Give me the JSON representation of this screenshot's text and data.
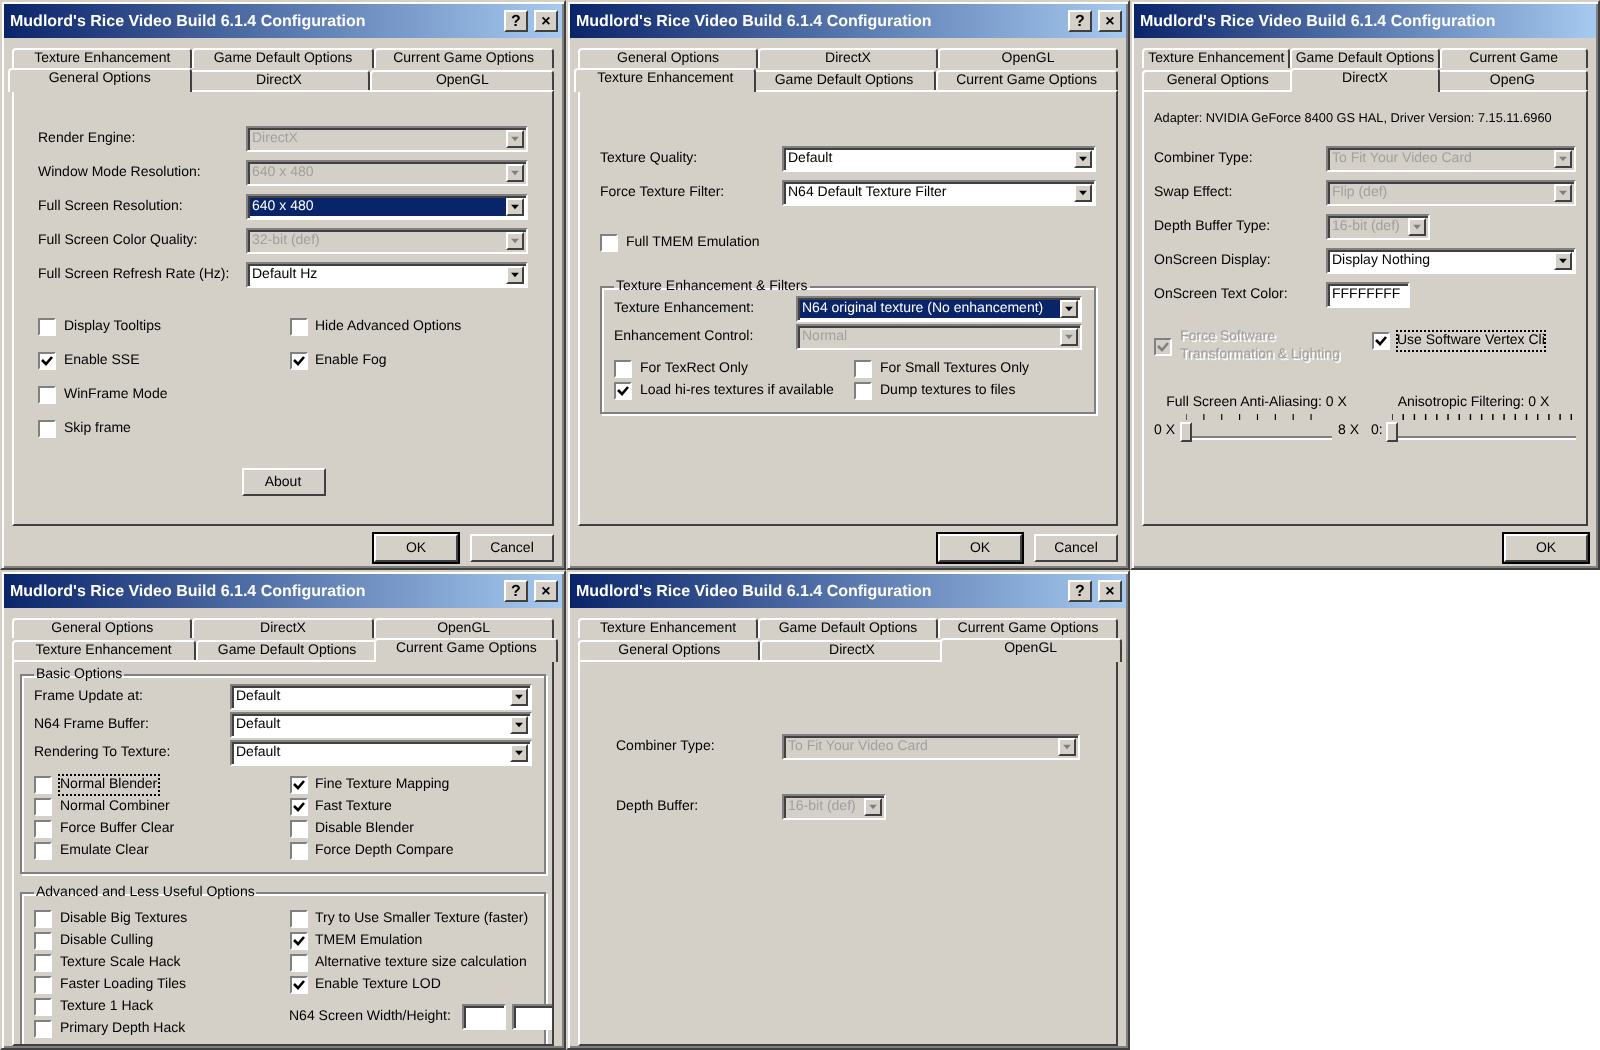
{
  "windows": [
    {
      "kind": "general",
      "title": "Mudlord's Rice Video Build 6.1.4 Configuration",
      "help": "?",
      "close": "×",
      "tab_rows": [
        [
          {
            "label": "Texture Enhancement",
            "selected": false
          },
          {
            "label": "Game Default Options",
            "selected": false
          },
          {
            "label": "Current Game Options",
            "selected": false
          }
        ],
        [
          {
            "label": "General Options",
            "selected": true
          },
          {
            "label": "DirectX",
            "selected": false
          },
          {
            "label": "OpenGL",
            "selected": false
          }
        ]
      ],
      "blocks": [
        {
          "kind": "select",
          "label": "Render Engine:",
          "value": "DirectX",
          "disabled": true,
          "focused": false
        },
        {
          "kind": "select",
          "label": "Window Mode Resolution:",
          "value": "640 x 480",
          "disabled": true,
          "focused": false
        },
        {
          "kind": "select",
          "label": "Full Screen Resolution:",
          "value": "640 x 480",
          "disabled": false,
          "focused": true
        },
        {
          "kind": "select",
          "label": "Full Screen Color Quality:",
          "value": "32-bit (def)",
          "disabled": true,
          "focused": false
        },
        {
          "kind": "select",
          "label": "Full Screen Refresh Rate (Hz):",
          "value": "Default Hz",
          "disabled": false,
          "focused": false
        },
        {
          "kind": "checks",
          "columns": [
            [
              {
                "kind": "check",
                "label": "Display Tooltips",
                "checked": false,
                "disabled": false,
                "focused": false
              },
              {
                "kind": "check",
                "label": "Enable SSE",
                "checked": true,
                "disabled": false,
                "focused": false
              },
              {
                "kind": "check",
                "label": "WinFrame Mode",
                "checked": false,
                "disabled": false,
                "focused": false
              },
              {
                "kind": "check",
                "label": "Skip frame",
                "checked": false,
                "disabled": false,
                "focused": false
              }
            ],
            [
              {
                "kind": "check",
                "label": "Hide Advanced Options",
                "checked": false,
                "disabled": false,
                "focused": false
              },
              {
                "kind": "check",
                "label": "Enable Fog",
                "checked": true,
                "disabled": false,
                "focused": false
              }
            ]
          ]
        },
        {
          "kind": "button",
          "label": "About"
        }
      ],
      "buttons": [
        "OK",
        "Cancel"
      ]
    },
    {
      "kind": "texture",
      "title": "Mudlord's Rice Video Build 6.1.4 Configuration",
      "help": "?",
      "close": "×",
      "tab_rows": [
        [
          {
            "label": "General Options",
            "selected": false
          },
          {
            "label": "DirectX",
            "selected": false
          },
          {
            "label": "OpenGL",
            "selected": false
          }
        ],
        [
          {
            "label": "Texture Enhancement",
            "selected": true
          },
          {
            "label": "Game Default Options",
            "selected": false
          },
          {
            "label": "Current Game Options",
            "selected": false
          }
        ]
      ],
      "blocks": [
        {
          "kind": "select",
          "label": "Texture Quality:",
          "value": "Default",
          "disabled": false,
          "focused": false
        },
        {
          "kind": "select",
          "label": "Force Texture Filter:",
          "value": "N64 Default Texture Filter",
          "disabled": false,
          "focused": false
        },
        {
          "kind": "checks",
          "columns": [
            [
              {
                "kind": "check",
                "label": "Full TMEM Emulation",
                "checked": false,
                "disabled": false,
                "focused": false
              }
            ]
          ]
        },
        {
          "kind": "group",
          "title": "Texture Enhancement & Filters",
          "blocks": [
            {
              "kind": "select",
              "label": "Texture Enhancement:",
              "value": "N64 original texture (No enhancement)",
              "disabled": false,
              "focused": true
            },
            {
              "kind": "select",
              "label": "Enhancement Control:",
              "value": "Normal",
              "disabled": true,
              "focused": false
            },
            {
              "kind": "checks",
              "columns": [
                [
                  {
                    "kind": "check",
                    "label": "For TexRect Only",
                    "checked": false,
                    "disabled": false,
                    "focused": false
                  },
                  {
                    "kind": "check",
                    "label": "Load hi-res textures if available",
                    "checked": true,
                    "disabled": false,
                    "focused": false
                  }
                ],
                [
                  {
                    "kind": "check",
                    "label": "For Small Textures Only",
                    "checked": false,
                    "disabled": false,
                    "focused": false
                  },
                  {
                    "kind": "check",
                    "label": "Dump textures to files",
                    "checked": false,
                    "disabled": false,
                    "focused": false
                  }
                ]
              ]
            }
          ]
        }
      ],
      "buttons": [
        "OK",
        "Cancel"
      ]
    },
    {
      "kind": "directx",
      "title": "Mudlord's Rice Video Build 6.1.4 Configuration",
      "tab_rows": [
        [
          {
            "label": "Texture Enhancement",
            "selected": false
          },
          {
            "label": "Game Default Options",
            "selected": false
          },
          {
            "label": "Current Game",
            "selected": false
          }
        ],
        [
          {
            "label": "General Options",
            "selected": false
          },
          {
            "label": "DirectX",
            "selected": true
          },
          {
            "label": "OpenG",
            "selected": false
          }
        ]
      ],
      "blocks": [
        {
          "kind": "text",
          "text": "Adapter: NVIDIA GeForce 8400 GS HAL, Driver Version: 7.15.11.6960"
        },
        {
          "kind": "select",
          "label": "Combiner Type:",
          "value": "To Fit Your Video Card",
          "disabled": true,
          "focused": false
        },
        {
          "kind": "select",
          "label": "Swap Effect:",
          "value": "Flip (def)",
          "disabled": true,
          "focused": false
        },
        {
          "kind": "short-select",
          "label": "Depth Buffer Type:",
          "value": "16-bit (def)",
          "disabled": true,
          "focused": false
        },
        {
          "kind": "select",
          "label": "OnScreen Display:",
          "value": "Display Nothing",
          "disabled": false,
          "focused": false
        },
        {
          "kind": "input",
          "label": "OnScreen Text Color:",
          "value": "FFFFFFFF"
        },
        {
          "kind": "checks",
          "columns": [
            [
              {
                "kind": "check",
                "label": "Force Software Transformation & Lighting",
                "checked": true,
                "disabled": true,
                "focused": false
              }
            ],
            [
              {
                "kind": "check",
                "label": "Use Software Vertex Cli",
                "checked": true,
                "disabled": false,
                "focused": true
              }
            ]
          ]
        },
        {
          "kind": "sliders",
          "items": [
            {
              "label": "Full Screen Anti-Aliasing: 0 X",
              "min": "0 X",
              "max": "8 X",
              "level": 0
            },
            {
              "label": "Anisotropic Filtering: 0 X",
              "min": "0:",
              "level": 0
            }
          ]
        }
      ],
      "buttons": [
        "OK"
      ]
    },
    {
      "kind": "current",
      "title": "Mudlord's Rice Video Build 6.1.4 Configuration",
      "help": "?",
      "close": "×",
      "tab_rows": [
        [
          {
            "label": "General Options",
            "selected": false
          },
          {
            "label": "DirectX",
            "selected": false
          },
          {
            "label": "OpenGL",
            "selected": false
          }
        ],
        [
          {
            "label": "Texture Enhancement",
            "selected": false
          },
          {
            "label": "Game Default Options",
            "selected": false
          },
          {
            "label": "Current Game Options",
            "selected": true
          }
        ]
      ],
      "blocks": [
        {
          "kind": "group",
          "title": "Basic Options",
          "blocks": [
            {
              "kind": "select",
              "label": "Frame Update at:",
              "value": "Default",
              "disabled": false,
              "focused": false
            },
            {
              "kind": "select",
              "label": "N64 Frame Buffer:",
              "value": "Default",
              "disabled": false,
              "focused": false
            },
            {
              "kind": "select",
              "label": "Rendering To Texture:",
              "value": "Default",
              "disabled": false,
              "focused": false
            },
            {
              "kind": "checks",
              "columns": [
                [
                  {
                    "kind": "check",
                    "label": "Normal Blender",
                    "checked": false,
                    "disabled": false,
                    "focused": true
                  },
                  {
                    "kind": "check",
                    "label": "Normal Combiner",
                    "checked": false,
                    "disabled": false,
                    "focused": false
                  },
                  {
                    "kind": "check",
                    "label": "Force Buffer Clear",
                    "checked": false,
                    "disabled": false,
                    "focused": false
                  },
                  {
                    "kind": "check",
                    "label": "Emulate Clear",
                    "checked": false,
                    "disabled": false,
                    "focused": false
                  }
                ],
                [
                  {
                    "kind": "check",
                    "label": "Fine Texture Mapping",
                    "checked": true,
                    "disabled": false,
                    "focused": false
                  },
                  {
                    "kind": "check",
                    "label": "Fast Texture",
                    "checked": true,
                    "disabled": false,
                    "focused": false
                  },
                  {
                    "kind": "check",
                    "label": "Disable Blender",
                    "checked": false,
                    "disabled": false,
                    "focused": false
                  },
                  {
                    "kind": "check",
                    "label": "Force Depth Compare",
                    "checked": false,
                    "disabled": false,
                    "focused": false
                  }
                ]
              ]
            }
          ]
        },
        {
          "kind": "group",
          "title": "Advanced and Less Useful Options",
          "blocks": [
            {
              "kind": "checks",
              "columns": [
                [
                  {
                    "kind": "check",
                    "label": "Disable Big Textures",
                    "checked": false,
                    "disabled": false,
                    "focused": false
                  },
                  {
                    "kind": "check",
                    "label": "Disable Culling",
                    "checked": false,
                    "disabled": false,
                    "focused": false
                  },
                  {
                    "kind": "check",
                    "label": "Texture Scale Hack",
                    "checked": false,
                    "disabled": false,
                    "focused": false
                  },
                  {
                    "kind": "check",
                    "label": "Faster Loading Tiles",
                    "checked": false,
                    "disabled": false,
                    "focused": false
                  },
                  {
                    "kind": "check",
                    "label": "Texture 1 Hack",
                    "checked": false,
                    "disabled": false,
                    "focused": false
                  },
                  {
                    "kind": "check",
                    "label": "Primary Depth Hack",
                    "checked": false,
                    "disabled": false,
                    "focused": false
                  }
                ],
                [
                  {
                    "kind": "check",
                    "label": "Try to Use Smaller Texture (faster)",
                    "checked": false,
                    "disabled": false,
                    "focused": false
                  },
                  {
                    "kind": "check",
                    "label": "TMEM Emulation",
                    "checked": true,
                    "disabled": false,
                    "focused": false
                  },
                  {
                    "kind": "check",
                    "label": "Alternative texture size calculation",
                    "checked": false,
                    "disabled": false,
                    "focused": false
                  },
                  {
                    "kind": "check",
                    "label": "Enable Texture LOD",
                    "checked": true,
                    "disabled": false,
                    "focused": false
                  },
                  {
                    "kind": "input-pair",
                    "label": "N64 Screen Width/Height:"
                  }
                ]
              ]
            }
          ]
        }
      ]
    },
    {
      "kind": "opengl",
      "title": "Mudlord's Rice Video Build 6.1.4 Configuration",
      "help": "?",
      "close": "×",
      "tab_rows": [
        [
          {
            "label": "Texture Enhancement",
            "selected": false
          },
          {
            "label": "Game Default Options",
            "selected": false
          },
          {
            "label": "Current Game Options",
            "selected": false
          }
        ],
        [
          {
            "label": "General Options",
            "selected": false
          },
          {
            "label": "DirectX",
            "selected": false
          },
          {
            "label": "OpenGL",
            "selected": true
          }
        ]
      ],
      "blocks": [
        {
          "kind": "select",
          "label": "Combiner Type:",
          "value": "To Fit Your Video Card",
          "disabled": true,
          "focused": false
        },
        {
          "kind": "short-select",
          "label": "Depth Buffer:",
          "value": "16-bit (def)",
          "disabled": true,
          "focused": false
        }
      ]
    }
  ]
}
